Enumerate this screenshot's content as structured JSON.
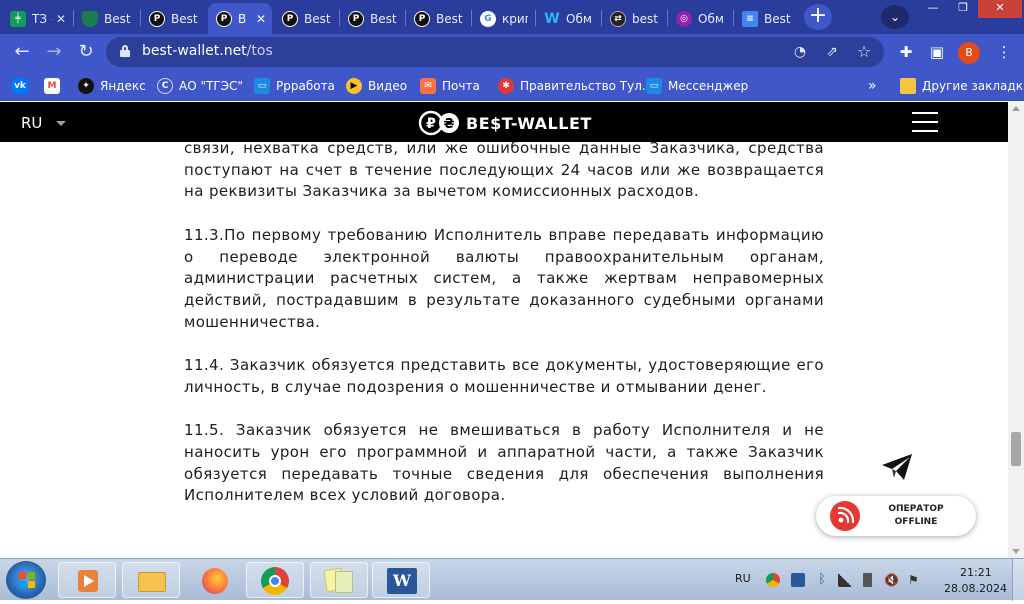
{
  "browser": {
    "tabs": [
      {
        "title": "ТЗ –",
        "icon": "sheets-icon",
        "color": "#0f9d58"
      },
      {
        "title": "Best",
        "icon": "shield-icon",
        "color": "#1b7f4b"
      },
      {
        "title": "Best",
        "icon": "bestwallet-icon",
        "color": "#111111"
      },
      {
        "title": "B",
        "icon": "bestwallet-icon",
        "color": "#111111",
        "active": true
      },
      {
        "title": "Best",
        "icon": "bestwallet-icon",
        "color": "#111111"
      },
      {
        "title": "Best",
        "icon": "bestwallet-icon",
        "color": "#111111"
      },
      {
        "title": "Best",
        "icon": "bestwallet-icon",
        "color": "#111111"
      },
      {
        "title": "криг",
        "icon": "google-icon",
        "color": "#ffffff"
      },
      {
        "title": "Обм",
        "icon": "w-icon",
        "color": "#1e88e5"
      },
      {
        "title": "best",
        "icon": "exchange-icon",
        "color": "#222222"
      },
      {
        "title": "Обм",
        "icon": "coin-icon",
        "color": "#8e24aa"
      },
      {
        "title": "Best",
        "icon": "docs-icon",
        "color": "#4285f4"
      }
    ],
    "url_host": "best-wallet.net",
    "url_path": "/tos",
    "profile_letter": "B",
    "bookmarks": [
      {
        "label": "",
        "icon": "vk-icon",
        "color": "#0077ff"
      },
      {
        "label": "",
        "icon": "gmail-icon",
        "color": "#ea4335"
      },
      {
        "label": "Яндекс",
        "icon": "yandex-icon",
        "color": "#111111"
      },
      {
        "label": "АО \"ТГЭС\"",
        "icon": "tges-icon",
        "color": "#3f57c8"
      },
      {
        "label": "Ррработа",
        "icon": "chat-icon",
        "color": "#1e88e5"
      },
      {
        "label": "Видео",
        "icon": "play-icon",
        "color": "#fbc02d"
      },
      {
        "label": "Почта",
        "icon": "mail-icon",
        "color": "#ff7043"
      },
      {
        "label": "Правительство Тул...",
        "icon": "gov-icon",
        "color": "#e53935"
      },
      {
        "label": "Мессенджер",
        "icon": "messenger-icon",
        "color": "#1e88e5"
      }
    ],
    "more_bookmarks": "»",
    "other_bookmarks": "Другие закладки"
  },
  "site": {
    "language": "RU",
    "logo_text": "BE$T-WALLET"
  },
  "document": {
    "paragraphs": [
      "связи, нехватка средств, или же ошибочные данные Заказчика, средства поступают на счет в течение последующих 24 часов или же возвращается на реквизиты Заказчика за вычетом комиссионных расходов.",
      "11.3.По первому требованию Исполнитель вправе передавать информацию о переводе электронной валюты правоохранительным органам, администрации расчетных систем, а также жертвам неправомерных действий, пострадавшим в результате доказанного судебными органами мошенничества.",
      "11.4. Заказчик обязуется представить все документы, удостоверяющие его личность, в случае подозрения о мошенничестве и отмывании денег.",
      "11.5. Заказчик обязуется не вмешиваться в работу Исполнителя и не наносить урон его программной и аппаратной части, а также Заказчик обязуется передавать точные сведения для обеспечения выполнения Исполнителем всех условий договора."
    ]
  },
  "chat_widget": {
    "line1": "ОПЕРАТОР",
    "line2": "OFFLINE"
  },
  "taskbar": {
    "apps": [
      "media-player-icon",
      "file-explorer-icon",
      "firefox-icon",
      "chrome-icon",
      "notes-icon",
      "word-icon"
    ],
    "language": "RU",
    "time": "21:21",
    "date": "28.08.2024"
  }
}
